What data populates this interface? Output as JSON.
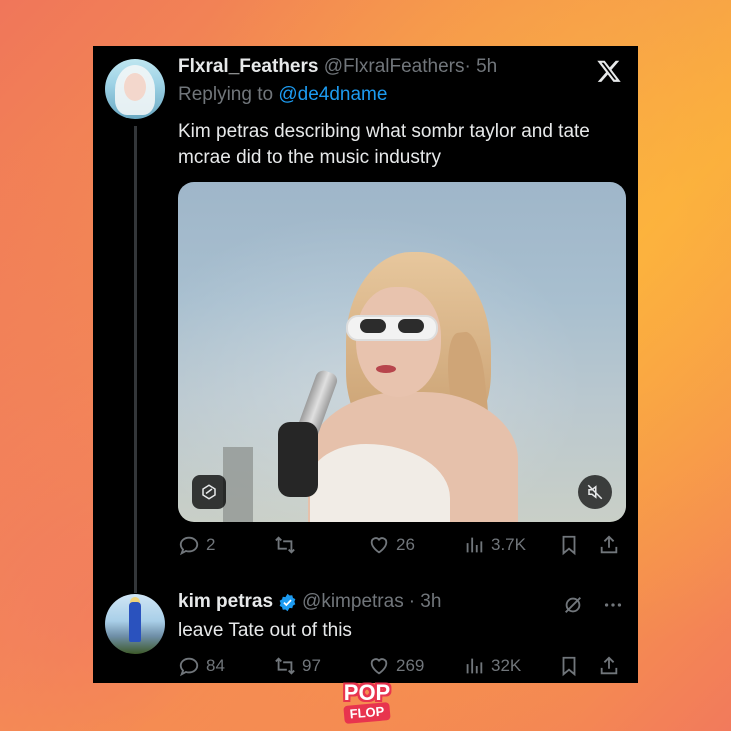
{
  "tweet": {
    "display_name": "Flxral_Feathers",
    "handle": "@FlxralFeathers",
    "time": "· 5h",
    "replying_prefix": "Replying to ",
    "replying_to": "@de4dname",
    "text": "Kim petras describing what sombr taylor and tate mcrae did to the music industry",
    "stats": {
      "replies": "2",
      "retweets": "",
      "likes": "26",
      "views": "3.7K"
    }
  },
  "reply": {
    "display_name": "kim petras",
    "handle": "@kimpetras",
    "time": "· 3h",
    "text": "leave Tate out of this",
    "stats": {
      "replies": "84",
      "retweets": "97",
      "likes": "269",
      "views": "32K"
    }
  },
  "watermark": {
    "line1": "POP",
    "line2": "FLOP"
  },
  "colors": {
    "card_bg": "#000000",
    "text_primary": "#e7e9ea",
    "text_secondary": "#71767b",
    "link": "#1d9bf0",
    "verified": "#1d9bf0",
    "brand": "#e8344e"
  },
  "icons": [
    "x-logo-icon",
    "reply-icon",
    "retweet-icon",
    "like-icon",
    "views-icon",
    "bookmark-icon",
    "share-icon",
    "mute-icon",
    "verified-icon",
    "grok-icon",
    "more-icon"
  ]
}
